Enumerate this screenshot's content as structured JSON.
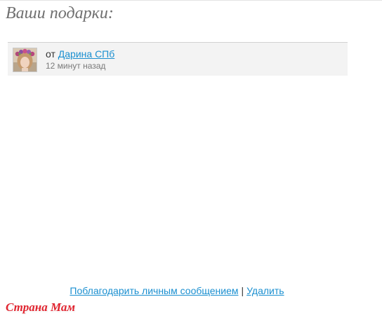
{
  "page": {
    "title": "Ваши подарки:"
  },
  "gift": {
    "from_prefix": "от",
    "sender_name": "Дарина СПб",
    "time_ago": "12 минут назад",
    "avatar_icon": "user-avatar-photo"
  },
  "actions": {
    "thank_label": "Поблагодарить личным сообщением",
    "separator": "|",
    "delete_label": "Удалить"
  },
  "brand": {
    "logo_text": "Страна Мам"
  },
  "colors": {
    "link": "#1a8fd0",
    "title": "#6f6f6f",
    "card_bg": "#f3f3f3",
    "logo": "#e0242f"
  }
}
